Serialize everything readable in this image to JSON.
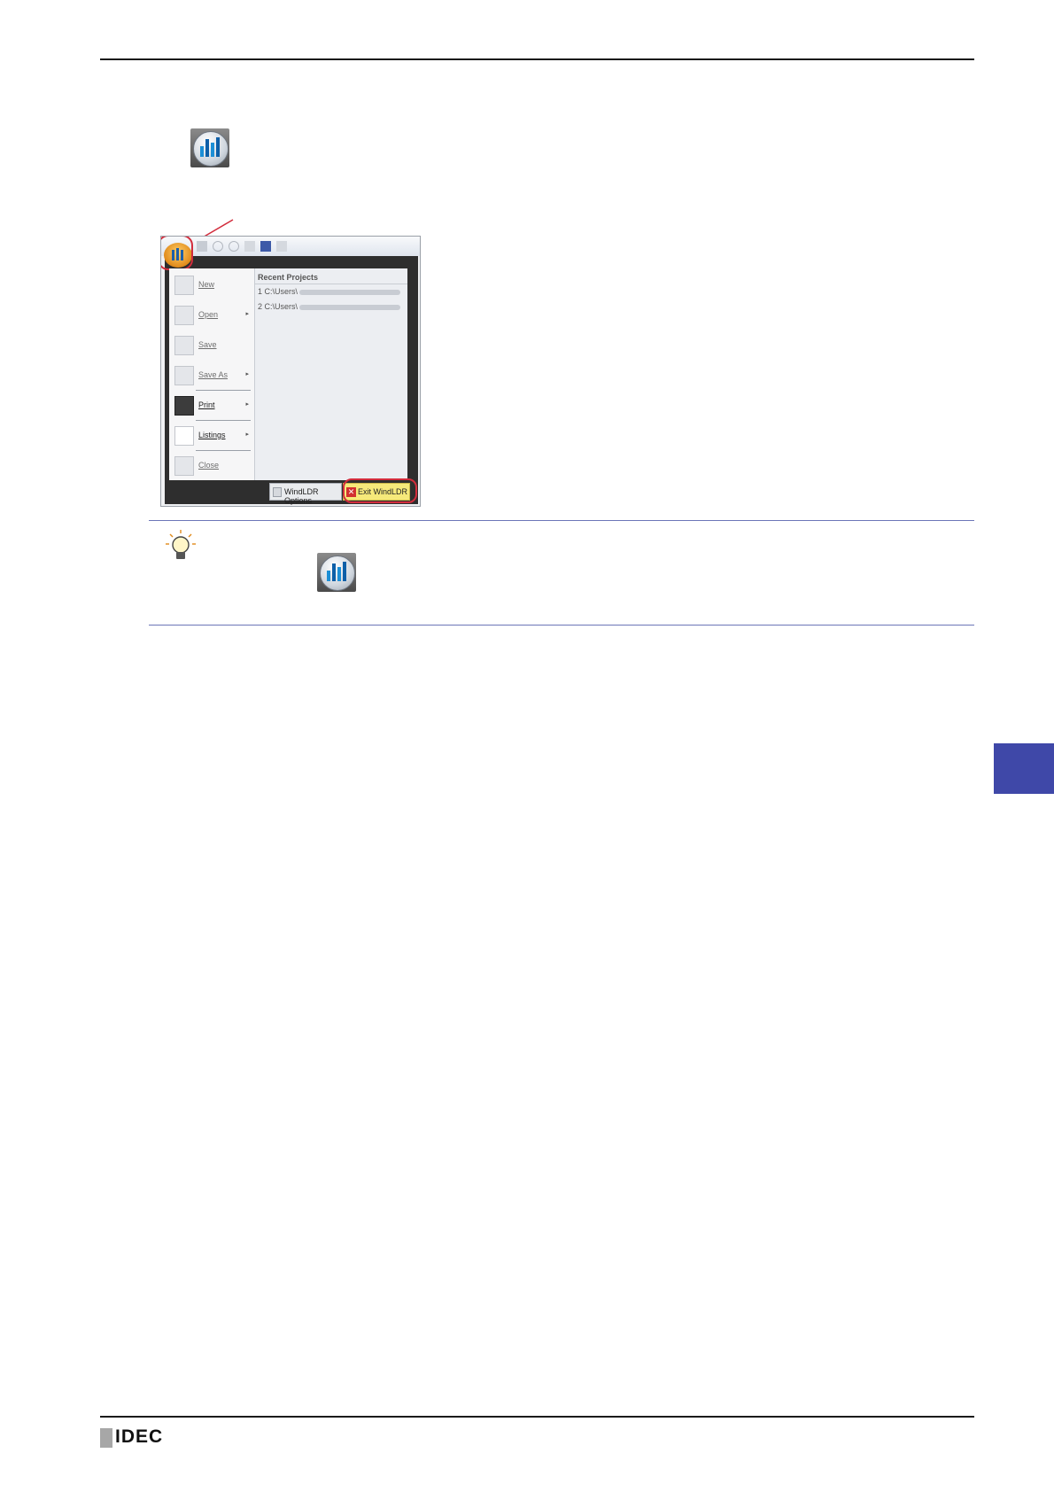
{
  "brand": {
    "logo_text": "IDEC"
  },
  "screenshot": {
    "recent_header": "Recent Projects",
    "recent_items": [
      "1 C:\\Users\\",
      "2 C:\\Users\\"
    ],
    "menu_items": [
      {
        "label": "New",
        "has_submenu": false
      },
      {
        "label": "Open",
        "has_submenu": true
      },
      {
        "label": "Save",
        "has_submenu": false
      },
      {
        "label": "Save As",
        "has_submenu": true
      },
      {
        "label": "Print",
        "has_submenu": true
      },
      {
        "label": "Listings",
        "has_submenu": true
      },
      {
        "label": "Close",
        "has_submenu": false
      }
    ],
    "submenu_arrow": "▸",
    "options_button": "WindLDR Options",
    "exit_button": "Exit WindLDR"
  },
  "colors": {
    "accent": "#3f48a8",
    "highlight_ring": "#d22c3c",
    "exit_bg": "#f6e97a"
  },
  "icons": [
    "windldr-application-icon",
    "lightbulb-tip-icon"
  ]
}
